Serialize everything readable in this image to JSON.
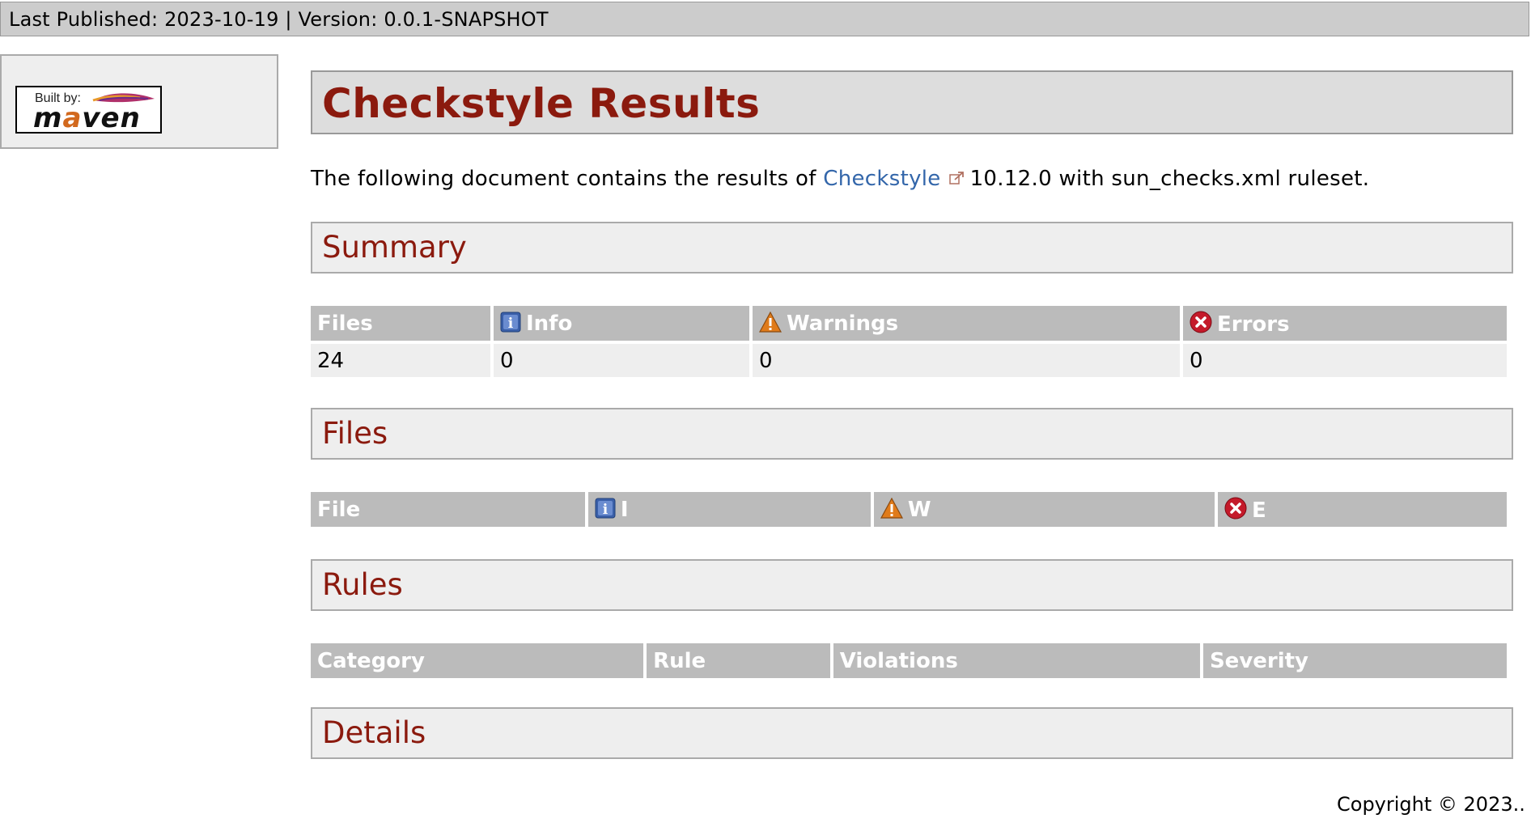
{
  "topbar": {
    "last_published_label": "Last Published: 2023-10-19",
    "separator": "|",
    "version_label": "Version: 0.0.1-SNAPSHOT"
  },
  "badge": {
    "built_by": "Built by:",
    "maven_pre": "m",
    "maven_a": "a",
    "maven_post": "ven"
  },
  "page": {
    "title": "Checkstyle Results",
    "intro_before": "The following document contains the results of ",
    "intro_link": "Checkstyle",
    "intro_after": "10.12.0 with sun_checks.xml ruleset."
  },
  "summary": {
    "heading": "Summary",
    "headers": [
      "Files",
      "Info",
      "Warnings",
      "Errors"
    ],
    "row": [
      "24",
      "0",
      "0",
      "0"
    ]
  },
  "files": {
    "heading": "Files",
    "headers": [
      "File",
      "I",
      "W",
      "E"
    ]
  },
  "rules": {
    "heading": "Rules",
    "headers": [
      "Category",
      "Rule",
      "Violations",
      "Severity"
    ]
  },
  "details": {
    "heading": "Details"
  },
  "footer": {
    "copyright": "Copyright © 2023.."
  },
  "icons": {
    "info": "info-icon",
    "warning": "warning-icon",
    "error": "error-icon",
    "external": "external-link-icon"
  },
  "colors": {
    "heading": "#8b1a0e",
    "link": "#3366aa",
    "table_header": "#bbbbbb",
    "box_bg": "#eeeeee"
  }
}
